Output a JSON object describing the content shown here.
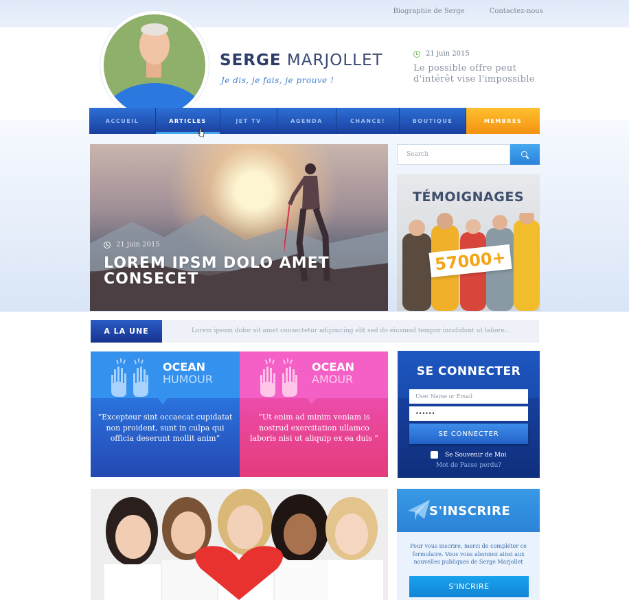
{
  "top_links": [
    "Biographie de Serge",
    "Contactez-nous"
  ],
  "site": {
    "first_name": "SERGE",
    "last_name": " MARJOLLET",
    "tagline": "Je dis, je fais, je prouve !"
  },
  "header_news": {
    "date": "21 juin 2015",
    "text": "Le possible offre peut d'intérêt vise l'impossible"
  },
  "nav": {
    "items": [
      "ACCUEIL",
      "ARTICLES",
      "JET TV",
      "AGENDA",
      "CHANCE!",
      "BOUTIQUE",
      "MEMBRES"
    ],
    "active": "ARTICLES"
  },
  "hero": {
    "date": "21 juin 2015",
    "title": "LOREM IPSM DOLO AMET CONSECET"
  },
  "search": {
    "placeholder": "Search"
  },
  "testimonials": {
    "title": "TÉMOIGNAGES",
    "count": "57000+"
  },
  "a_la_une": {
    "label": "A LA UNE",
    "ticker": "Lorem ipsum dolor sit amet consectetur adipisicing elit sed do eiusmod tempor incididunt ut labore..."
  },
  "cards": [
    {
      "title1": "OCEAN",
      "title2": "HUMOUR",
      "quote": "“Excepteur sint occaecat cupidatat non proident, sunt in culpa qui officia deserunt mollit anim”",
      "color": "#2e7ee2"
    },
    {
      "title1": "OCEAN",
      "title2": "AMOUR",
      "quote": "“Ut enim ad minim veniam is nostrud exercitation ullamco laboris nisi ut aliquip ex ea  duis ”",
      "color": "#ef4fbb"
    }
  ],
  "login": {
    "title": "SE CONNECTER",
    "username_placeholder": "User Name or Email",
    "password_value": "******",
    "button": "SE CONNECTER",
    "remember": "Se Souvenir de Moi",
    "forgot": "Mot de Passe perdu?"
  },
  "signup": {
    "title": "S'INSCRIRE",
    "text": "Pour vous inscrire, merci de compléter ce formulaire. Vous vous abonnez ainsi aux nouvelles publiques de Serge Marjollet",
    "button": "S'INCRIRE"
  },
  "colors": {
    "nav": "#1f51b8",
    "members": "#f7a81e",
    "accent": "#3f7fd0"
  },
  "icons": [
    "clock-icon",
    "search-icon",
    "hands-icon",
    "plane-icon",
    "cursor-icon"
  ]
}
